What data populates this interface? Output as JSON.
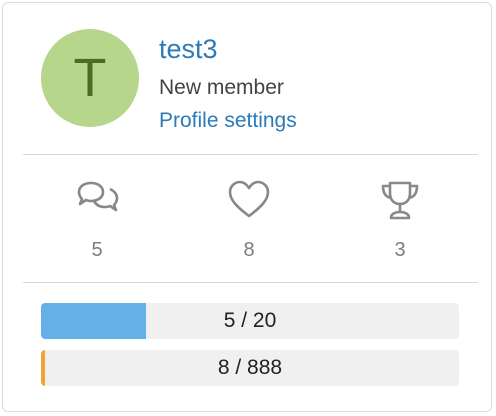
{
  "profile": {
    "avatar_letter": "T",
    "avatar_bg": "#b6d68c",
    "avatar_fg": "#4e6b26",
    "username": "test3",
    "member_title": "New member",
    "settings_label": "Profile settings"
  },
  "stats": [
    {
      "icon": "comments-icon",
      "value": "5"
    },
    {
      "icon": "heart-icon",
      "value": "8"
    },
    {
      "icon": "trophy-icon",
      "value": "3"
    }
  ],
  "progress": [
    {
      "label": "5 / 20",
      "fraction": 0.25,
      "color": "#66b0ea"
    },
    {
      "label": "8 / 888",
      "fraction": 0.009,
      "color": "#f0a535"
    }
  ]
}
